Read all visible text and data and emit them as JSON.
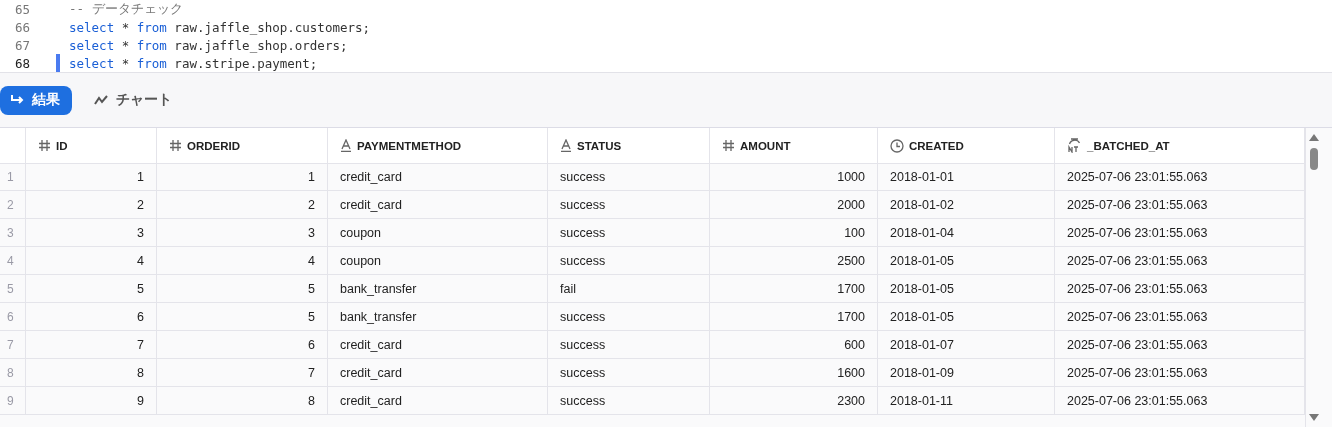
{
  "editor": {
    "lines": [
      {
        "number": "65",
        "current": false,
        "tokens": [
          {
            "text": "-- データチェック",
            "kind": "comment"
          }
        ]
      },
      {
        "number": "66",
        "current": false,
        "tokens": [
          {
            "text": "select",
            "kind": "keyword"
          },
          {
            "text": " * ",
            "kind": "plain"
          },
          {
            "text": "from",
            "kind": "keyword"
          },
          {
            "text": " raw.jaffle_shop.customers;",
            "kind": "plain"
          }
        ]
      },
      {
        "number": "67",
        "current": false,
        "tokens": [
          {
            "text": "select",
            "kind": "keyword"
          },
          {
            "text": " * ",
            "kind": "plain"
          },
          {
            "text": "from",
            "kind": "keyword"
          },
          {
            "text": " raw.jaffle_shop.orders;",
            "kind": "plain"
          }
        ]
      },
      {
        "number": "68",
        "current": true,
        "tokens": [
          {
            "text": "select",
            "kind": "keyword"
          },
          {
            "text": " * ",
            "kind": "plain"
          },
          {
            "text": "from",
            "kind": "keyword"
          },
          {
            "text": " raw.stripe.payment;",
            "kind": "plain"
          }
        ]
      }
    ]
  },
  "tabs": [
    {
      "label": "結果",
      "kind": "results",
      "selected": true
    },
    {
      "label": "チャート",
      "kind": "chart",
      "selected": false
    }
  ],
  "table": {
    "columns": [
      {
        "label": "ID",
        "kind": "number"
      },
      {
        "label": "ORDERID",
        "kind": "number"
      },
      {
        "label": "PAYMENTMETHOD",
        "kind": "text"
      },
      {
        "label": "STATUS",
        "kind": "text"
      },
      {
        "label": "AMOUNT",
        "kind": "number"
      },
      {
        "label": "CREATED",
        "kind": "date"
      },
      {
        "label": "_BATCHED_AT",
        "kind": "timestamp"
      }
    ],
    "rows": [
      {
        "number": "1",
        "cells": [
          "1",
          "1",
          "credit_card",
          "success",
          "1000",
          "2018-01-01",
          "2025-07-06 23:01:55.063"
        ]
      },
      {
        "number": "2",
        "cells": [
          "2",
          "2",
          "credit_card",
          "success",
          "2000",
          "2018-01-02",
          "2025-07-06 23:01:55.063"
        ]
      },
      {
        "number": "3",
        "cells": [
          "3",
          "3",
          "coupon",
          "success",
          "100",
          "2018-01-04",
          "2025-07-06 23:01:55.063"
        ]
      },
      {
        "number": "4",
        "cells": [
          "4",
          "4",
          "coupon",
          "success",
          "2500",
          "2018-01-05",
          "2025-07-06 23:01:55.063"
        ]
      },
      {
        "number": "5",
        "cells": [
          "5",
          "5",
          "bank_transfer",
          "fail",
          "1700",
          "2018-01-05",
          "2025-07-06 23:01:55.063"
        ]
      },
      {
        "number": "6",
        "cells": [
          "6",
          "5",
          "bank_transfer",
          "success",
          "1700",
          "2018-01-05",
          "2025-07-06 23:01:55.063"
        ]
      },
      {
        "number": "7",
        "cells": [
          "7",
          "6",
          "credit_card",
          "success",
          "600",
          "2018-01-07",
          "2025-07-06 23:01:55.063"
        ]
      },
      {
        "number": "8",
        "cells": [
          "8",
          "7",
          "credit_card",
          "success",
          "1600",
          "2018-01-09",
          "2025-07-06 23:01:55.063"
        ]
      },
      {
        "number": "9",
        "cells": [
          "9",
          "8",
          "credit_card",
          "success",
          "2300",
          "2018-01-11",
          "2025-07-06 23:01:55.063"
        ]
      }
    ]
  }
}
